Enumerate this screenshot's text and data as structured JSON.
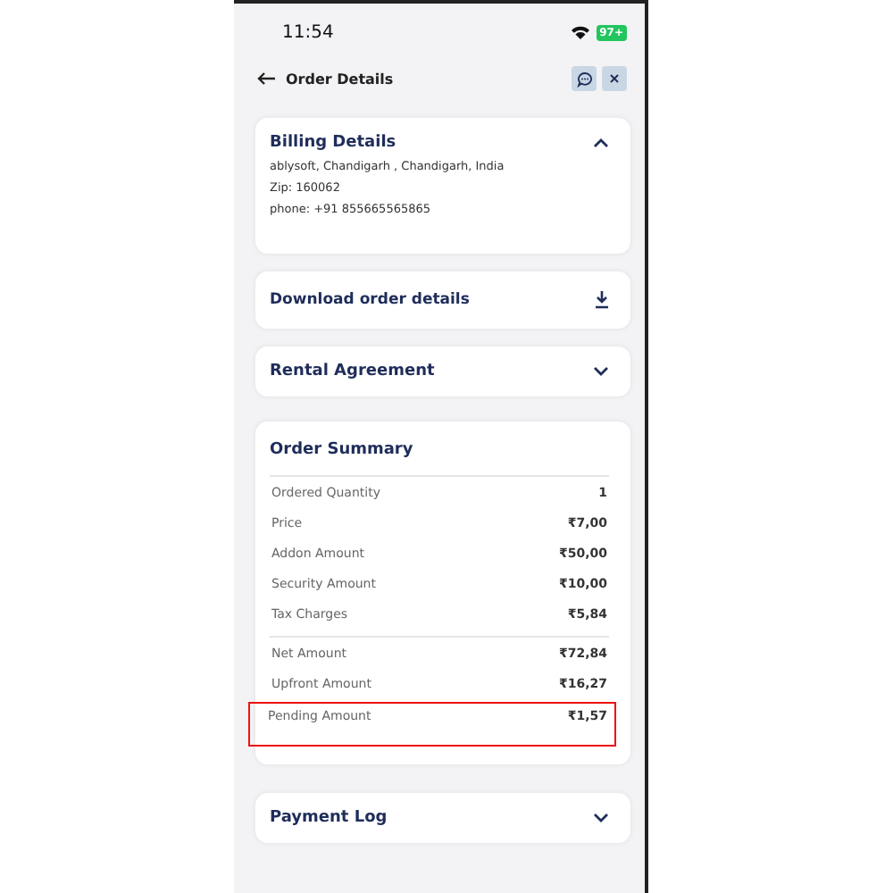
{
  "status_bar": {
    "time": "11:54",
    "battery": "97+"
  },
  "header": {
    "title": "Order Details"
  },
  "billing": {
    "title": "Billing Details",
    "expanded": true,
    "lines": [
      "ablysoft, Chandigarh , Chandigarh, India",
      "Zip: 160062",
      "phone: +91 855665565865"
    ]
  },
  "download": {
    "label": "Download order details"
  },
  "rental": {
    "title": "Rental Agreement",
    "expanded": false
  },
  "order_summary": {
    "title": "Order Summary",
    "groups": [
      [
        {
          "label": "Ordered Quantity",
          "value": "1",
          "highlighted": false
        },
        {
          "label": "Price",
          "value": "₹7,00",
          "highlighted": false
        },
        {
          "label": "Addon Amount",
          "value": "₹50,00",
          "highlighted": false
        },
        {
          "label": "Security Amount",
          "value": "₹10,00",
          "highlighted": false
        },
        {
          "label": "Tax Charges",
          "value": "₹5,84",
          "highlighted": false
        }
      ],
      [
        {
          "label": "Net Amount",
          "value": "₹72,84",
          "highlighted": false
        },
        {
          "label": "Upfront Amount",
          "value": "₹16,27",
          "highlighted": false
        },
        {
          "label": "Pending Amount",
          "value": "₹1,57",
          "highlighted": true
        }
      ]
    ]
  },
  "payment_log": {
    "title": "Payment Log",
    "expanded": false
  }
}
